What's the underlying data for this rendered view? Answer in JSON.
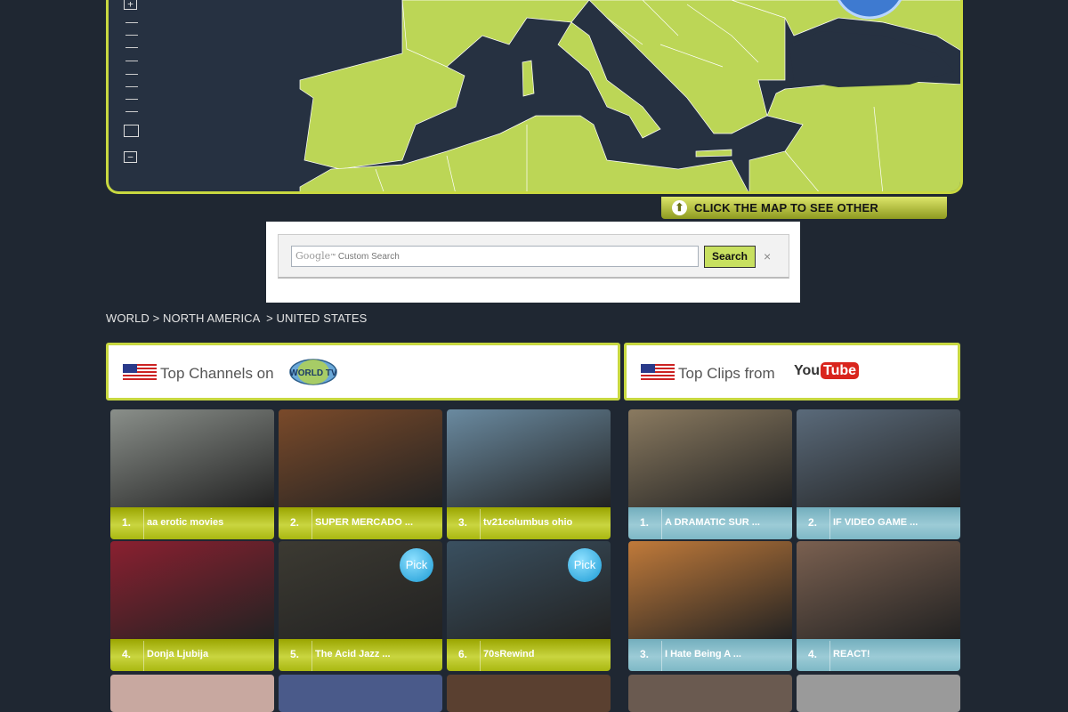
{
  "map": {
    "zoom_in_label": "+",
    "zoom_out_label": "−",
    "hint": "CLICK THE MAP TO SEE OTHER COUNTRIES",
    "colors": {
      "land": "#bcd656",
      "sea": "#263141",
      "frame": "#c8d840"
    }
  },
  "search": {
    "placeholder_brand": "Google",
    "placeholder_tm": "™",
    "placeholder_text": "Custom Search",
    "button": "Search",
    "clear": "×"
  },
  "breadcrumb": "WORLD > NORTH AMERICA  > UNITED STATES",
  "channels_panel": {
    "title": "Top Channels on",
    "logo_text": "WORLD TV",
    "flag_icon": "us-flag-icon"
  },
  "clips_panel": {
    "title": "Top Clips from",
    "logo_you": "You",
    "logo_tube": "Tube",
    "flag_icon": "us-flag-icon"
  },
  "channels": [
    {
      "rank": "1.",
      "title": "aa erotic movies",
      "pick": "",
      "thumb": "#8a8f8a"
    },
    {
      "rank": "2.",
      "title": "SUPER MERCADO ...",
      "pick": "",
      "thumb": "#7a4a2a"
    },
    {
      "rank": "3.",
      "title": "tv21columbus ohio",
      "pick": "",
      "thumb": "#6a8aa0"
    },
    {
      "rank": "4.",
      "title": "Donja Ljubija",
      "pick": "",
      "thumb": "#8a2030"
    },
    {
      "rank": "5.",
      "title": "The Acid Jazz ...",
      "pick": "Pick",
      "thumb": "#3c3a32"
    },
    {
      "rank": "6.",
      "title": "70sRewind",
      "pick": "Pick",
      "thumb": "#3a5060"
    }
  ],
  "clips": [
    {
      "rank": "1.",
      "title": "A DRAMATIC SUR ...",
      "thumb": "#8a7a60"
    },
    {
      "rank": "2.",
      "title": "IF VIDEO GAME ...",
      "thumb": "#5a6a7a"
    },
    {
      "rank": "3.",
      "title": "I Hate Being A ...",
      "thumb": "#c07a3a"
    },
    {
      "rank": "4.",
      "title": "REACT!",
      "thumb": "#7a6050"
    }
  ]
}
